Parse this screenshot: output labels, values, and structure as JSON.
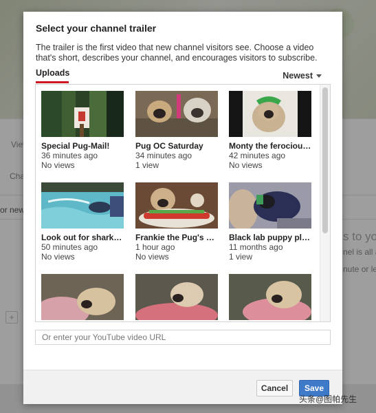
{
  "background": {
    "text_fragments": [
      "View",
      "Cha",
      "or new",
      "s to you",
      "nel is all a",
      "nute or le"
    ]
  },
  "dialog": {
    "title": "Select your channel trailer",
    "description": "The trailer is the first video that new channel visitors see. Choose a video that's short, describes your channel, and encourages visitors to subscribe.",
    "tab_label": "Uploads",
    "sort_label": "Newest",
    "videos": [
      {
        "title": "Special Pug-Mail!",
        "age": "36 minutes ago",
        "views": "No views"
      },
      {
        "title": "Pug OC Saturday",
        "age": "34 minutes ago",
        "views": "1 view"
      },
      {
        "title": "Monty the ferocious ...",
        "age": "42 minutes ago",
        "views": "No views"
      },
      {
        "title": "Look out for shark d...",
        "age": "50 minutes ago",
        "views": "No views"
      },
      {
        "title": "Frankie the Pug's Birt...",
        "age": "1 hour ago",
        "views": "No views"
      },
      {
        "title": "Black lab puppy play ...",
        "age": "11 months ago",
        "views": "1 view"
      },
      {
        "title": "",
        "age": "",
        "views": ""
      },
      {
        "title": "",
        "age": "",
        "views": ""
      },
      {
        "title": "",
        "age": "",
        "views": ""
      }
    ],
    "url_placeholder": "Or enter your YouTube video URL",
    "cancel_label": "Cancel",
    "save_label": "Save"
  },
  "watermark": {
    "text": "头条@图帕先生"
  }
}
